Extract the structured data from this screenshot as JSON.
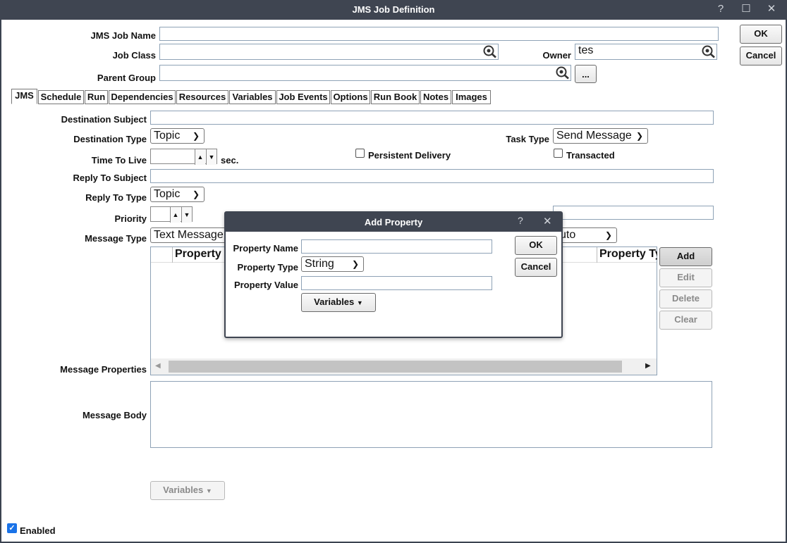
{
  "window": {
    "title": "JMS Job Definition",
    "help_glyph": "?",
    "maximize_glyph": "☐",
    "close_glyph": "✕"
  },
  "header": {
    "job_name_label": "JMS Job Name",
    "job_name_value": "",
    "job_class_label": "Job Class",
    "job_class_value": "",
    "owner_label": "Owner",
    "owner_value": "tes",
    "parent_group_label": "Parent Group",
    "parent_group_value": "",
    "browse_label": "...",
    "ok_label": "OK",
    "cancel_label": "Cancel"
  },
  "tabs": [
    "JMS",
    "Schedule",
    "Run",
    "Dependencies",
    "Resources",
    "Variables",
    "Job Events",
    "Options",
    "Run Book",
    "Notes",
    "Images"
  ],
  "jms": {
    "destination_subject_label": "Destination Subject",
    "destination_type_label": "Destination Type",
    "destination_type_value": "Topic",
    "task_type_label": "Task Type",
    "task_type_value": "Send Message",
    "time_to_live_label": "Time To Live",
    "time_to_live_unit": "sec.",
    "persistent_delivery_label": "Persistent Delivery",
    "persistent_delivery_checked": false,
    "transacted_label": "Transacted",
    "transacted_checked": false,
    "reply_to_subject_label": "Reply To Subject",
    "reply_to_type_label": "Reply To Type",
    "reply_to_type_value": "Topic",
    "priority_label": "Priority",
    "message_type_label": "Message Type",
    "message_type_value": "Text Message",
    "ack_mode_value_partial": "uto",
    "property_col_name": "Property N",
    "property_col_type": "Property Ty",
    "add_label": "Add",
    "edit_label": "Edit",
    "delete_label": "Delete",
    "clear_label": "Clear",
    "message_properties_label": "Message Properties",
    "message_body_label": "Message Body",
    "variables_label": "Variables",
    "enabled_label": "Enabled",
    "enabled_checked": true
  },
  "dialog": {
    "title": "Add Property",
    "help_glyph": "?",
    "close_glyph": "✕",
    "property_name_label": "Property Name",
    "property_name_value": "",
    "property_type_label": "Property Type",
    "property_type_value": "String",
    "property_value_label": "Property Value",
    "property_value_value": "",
    "variables_label": "Variables",
    "ok_label": "OK",
    "cancel_label": "Cancel"
  },
  "colors": {
    "titlebar": "#3f4551",
    "input_border": "#8ea2b6",
    "checkbox_accent": "#1a73e8"
  }
}
